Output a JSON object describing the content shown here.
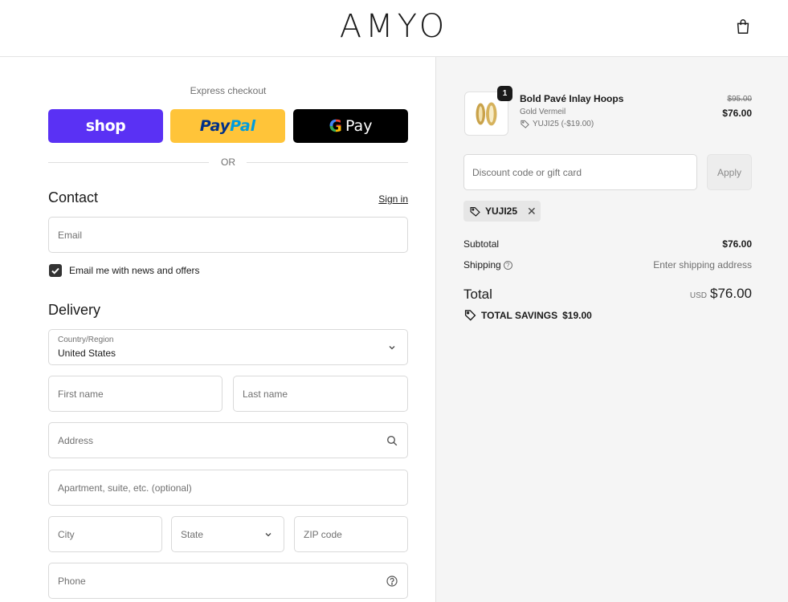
{
  "header": {
    "brand": "AMYO"
  },
  "express": {
    "label": "Express checkout",
    "shop_label": "shop",
    "paypal_part1": "Pay",
    "paypal_part2": "Pal",
    "gpay_g": "G",
    "gpay_label": "Pay",
    "or_label": "OR"
  },
  "contact": {
    "title": "Contact",
    "sign_in": "Sign in",
    "email_placeholder": "Email",
    "news_checked": true,
    "news_label": "Email me with news and offers"
  },
  "delivery": {
    "title": "Delivery",
    "country_label": "Country/Region",
    "country_value": "United States",
    "first_name_placeholder": "First name",
    "last_name_placeholder": "Last name",
    "address_placeholder": "Address",
    "apartment_placeholder": "Apartment, suite, etc. (optional)",
    "city_placeholder": "City",
    "state_placeholder": "State",
    "zip_placeholder": "ZIP code",
    "phone_placeholder": "Phone"
  },
  "order": {
    "quantity": "1",
    "product_name": "Bold Pavé Inlay Hoops",
    "variant": "Gold Vermeil",
    "discount_line": "YUJI25 (-$19.00)",
    "price_original": "$95.00",
    "price_current": "$76.00",
    "discount_placeholder": "Discount code or gift card",
    "apply_label": "Apply",
    "applied_code": "YUJI25",
    "remove_symbol": "✕"
  },
  "summary": {
    "subtotal_label": "Subtotal",
    "subtotal_value": "$76.00",
    "shipping_label": "Shipping",
    "shipping_value": "Enter shipping address",
    "total_label": "Total",
    "currency": "USD",
    "total_value": "$76.00",
    "savings_label": "TOTAL SAVINGS",
    "savings_value": "$19.00"
  },
  "colors": {
    "shop_purple": "#5a31f4",
    "paypal_yellow": "#ffc439",
    "gpay_black": "#000000",
    "summary_bg": "#f5f5f5"
  },
  "icons": [
    "shopping-bag-icon",
    "tag-icon",
    "search-icon",
    "help-circle-icon",
    "chevron-down-icon",
    "check-icon",
    "close-icon"
  ]
}
